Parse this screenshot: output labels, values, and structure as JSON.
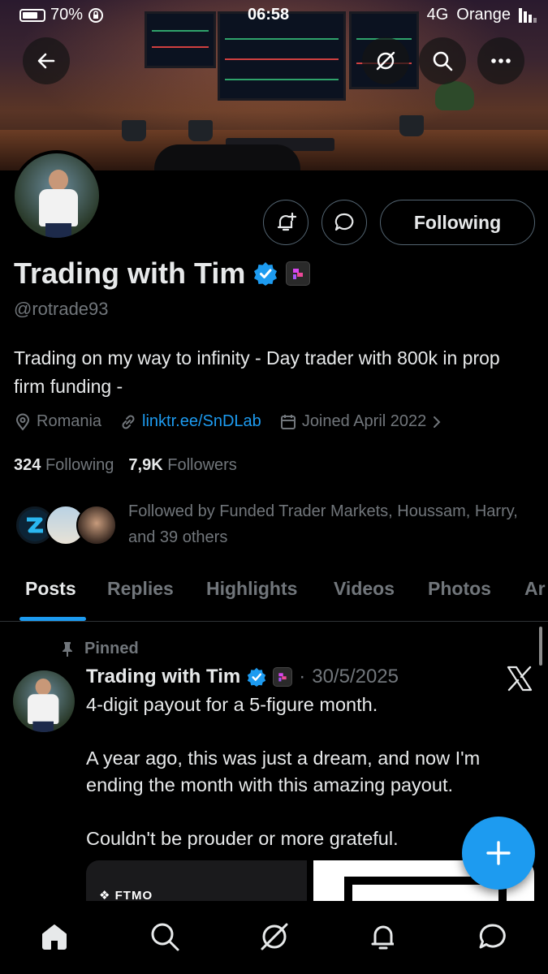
{
  "status_bar": {
    "battery": "70%",
    "time": "06:58",
    "network": "4G",
    "carrier": "Orange"
  },
  "profile": {
    "display_name": "Trading with Tim",
    "handle": "@rotrade93",
    "bio": "Trading on my way to infinity - Day trader with 800k in prop firm funding -",
    "location": "Romania",
    "website": "linktr.ee/SnDLab",
    "joined": "Joined April 2022",
    "following_count": "324",
    "following_label": "Following",
    "followers_count": "7,9K",
    "followers_label": "Followers",
    "followed_by": "Followed by Funded Trader Markets, Houssam, Harry, and 39 others",
    "follow_button": "Following"
  },
  "tabs": [
    "Posts",
    "Replies",
    "Highlights",
    "Videos",
    "Photos",
    "Ar"
  ],
  "post": {
    "pinned_label": "Pinned",
    "author": "Trading with Tim",
    "date": "30/5/2025",
    "paragraphs": [
      "4-digit payout for a 5-figure month.",
      "A year ago, this was just a dream, and now I'm ending the month with this amazing payout.",
      "Couldn't be prouder or more grateful."
    ],
    "media_brand": "FTMO"
  },
  "colors": {
    "accent": "#1d9bf0",
    "text": "#e7e9ea",
    "muted": "#71767b",
    "border": "#536471"
  }
}
